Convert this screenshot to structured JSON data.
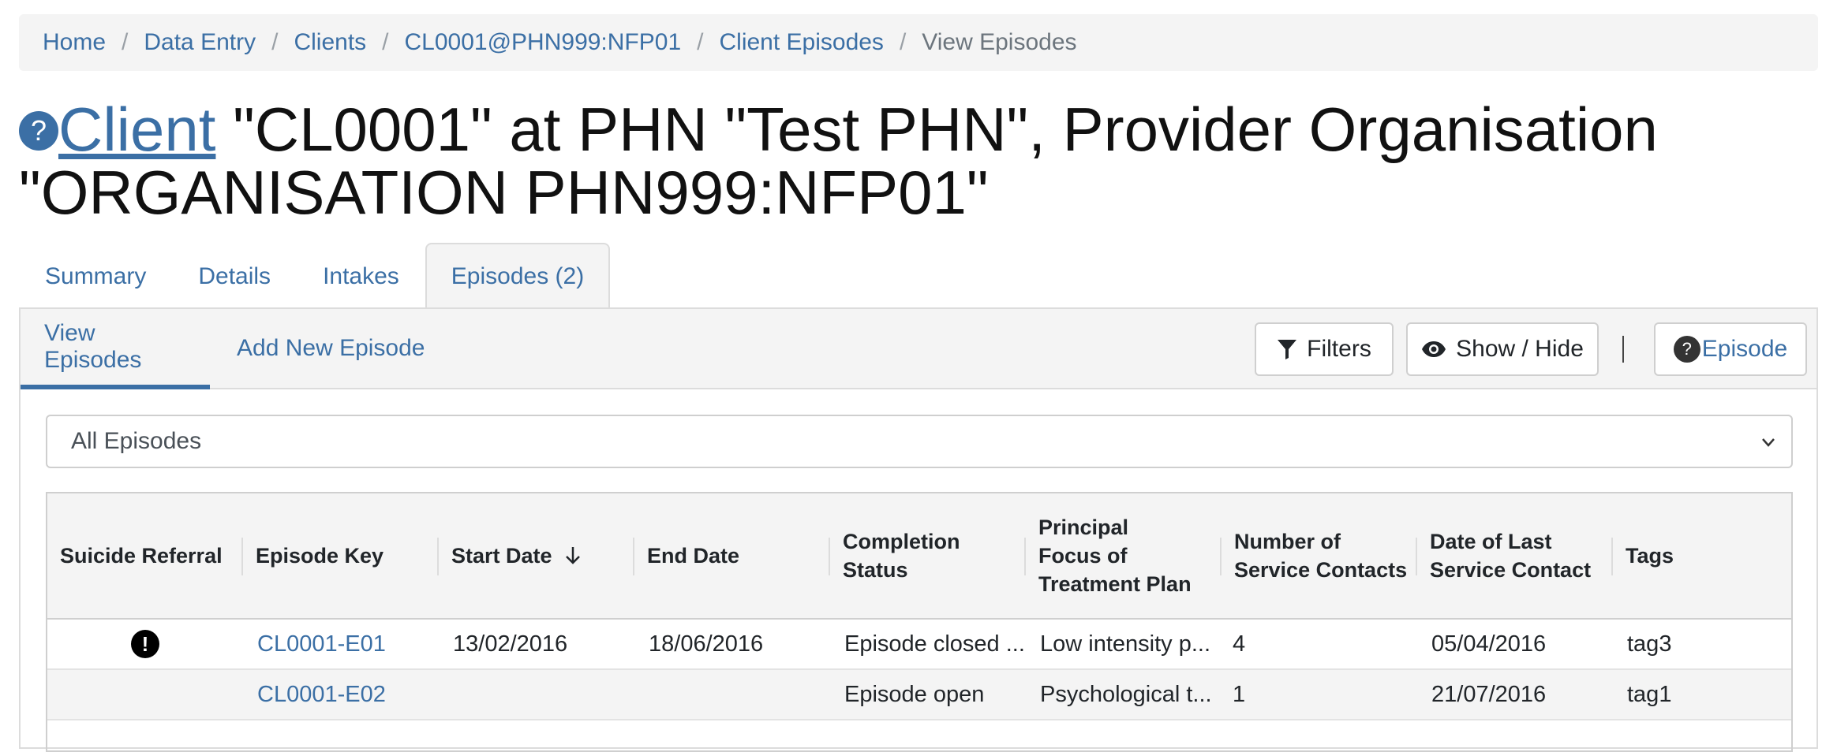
{
  "breadcrumb": {
    "items": [
      "Home",
      "Data Entry",
      "Clients",
      "CL0001@PHN999:NFP01",
      "Client Episodes"
    ],
    "current": "View Episodes",
    "separator": "/"
  },
  "title": {
    "help_glyph": "?",
    "link": "Client",
    "line1_rest": " \"CL0001\" at PHN \"Test PHN\", Provider Organisation",
    "line2": "\"ORGANISATION PHN999:NFP01\""
  },
  "tabs": [
    {
      "label": "Summary",
      "active": false
    },
    {
      "label": "Details",
      "active": false
    },
    {
      "label": "Intakes",
      "active": false
    },
    {
      "label": "Episodes (2)",
      "active": true
    }
  ],
  "subtabs": {
    "view": "View Episodes",
    "add": "Add New Episode"
  },
  "toolbar": {
    "filters": "Filters",
    "show_hide": "Show / Hide",
    "help_glyph": "?",
    "episode_help": "Episode"
  },
  "filter_select": {
    "value": "All Episodes"
  },
  "table": {
    "columns": {
      "suicide_referral": "Suicide Referral",
      "episode_key": "Episode Key",
      "start_date": "Start Date",
      "end_date": "End Date",
      "completion_status": "Completion Status",
      "principal_focus": "Principal Focus of Treatment Plan",
      "num_contacts": "Number of Service Contacts",
      "last_contact": "Date of Last Service Contact",
      "tags": "Tags"
    },
    "rows": [
      {
        "suicide_referral": "!",
        "episode_key": "CL0001-E01",
        "start_date": "13/02/2016",
        "end_date": "18/06/2016",
        "completion_status": "Episode closed ...",
        "principal_focus": "Low intensity p...",
        "num_contacts": "4",
        "last_contact": "05/04/2016",
        "tags": "tag3"
      },
      {
        "suicide_referral": "",
        "episode_key": "CL0001-E02",
        "start_date": "",
        "end_date": "",
        "completion_status": "Episode open",
        "principal_focus": "Psychological t...",
        "num_contacts": "1",
        "last_contact": "21/07/2016",
        "tags": "tag1"
      }
    ]
  },
  "colors": {
    "link": "#3b6fa5",
    "panel_bg": "#f4f4f4",
    "border": "#dcdcdc"
  }
}
